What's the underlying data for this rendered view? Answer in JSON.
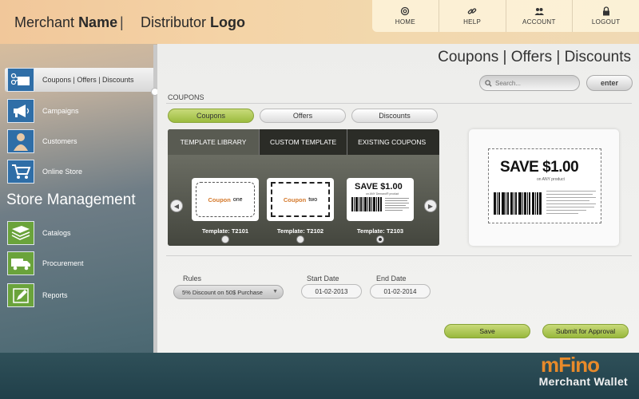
{
  "header": {
    "merchant_prefix": "Merchant",
    "merchant_bold": "Name",
    "separator": "|",
    "distributor_prefix": "Distributor",
    "distributor_bold": "Logo",
    "nav": [
      {
        "label": "HOME",
        "icon": "at-icon"
      },
      {
        "label": "HELP",
        "icon": "link-icon"
      },
      {
        "label": "ACCOUNT",
        "icon": "users-icon"
      },
      {
        "label": "LOGOUT",
        "icon": "lock-icon"
      }
    ]
  },
  "sidebar": {
    "items": [
      {
        "label": "Coupons | Offers | Discounts",
        "icon": "scissors-coupon-icon",
        "active": true
      },
      {
        "label": "Campaigns",
        "icon": "megaphone-icon"
      },
      {
        "label": "Customers",
        "icon": "person-icon"
      },
      {
        "label": "Online Store",
        "icon": "cart-icon"
      }
    ],
    "store_heading": "Store Management",
    "store_items": [
      {
        "label": "Catalogs",
        "icon": "catalog-icon"
      },
      {
        "label": "Procurement",
        "icon": "truck-icon"
      },
      {
        "label": "Reports",
        "icon": "pencil-icon"
      }
    ]
  },
  "main": {
    "page_title": "Coupons | Offers | Discounts",
    "search_placeholder": "Search...",
    "enter_label": "enter",
    "section_label": "COUPONS",
    "pills": [
      {
        "label": "Coupons",
        "active": true
      },
      {
        "label": "Offers"
      },
      {
        "label": "Discounts"
      }
    ],
    "template_tabs": [
      "TEMPLATE LIBRARY",
      "CUSTOM TEMPLATE",
      "EXISTING COUPONS"
    ],
    "templates": [
      {
        "label": "Template: T2101",
        "word": "Coupon",
        "suffix": "one"
      },
      {
        "label": "Template: T2102",
        "word": "Coupon",
        "suffix": "two"
      },
      {
        "label": "Template: T2103",
        "save": "SAVE $1.00",
        "sub": "on ANY Demand® product",
        "selected": true
      }
    ],
    "preview": {
      "save": "SAVE $1.00",
      "sub": "on ANY product"
    },
    "rules_label": "Rules",
    "rules_value": "5% Discount on 50$ Purchase",
    "start_date_label": "Start Date",
    "start_date": "01-02-2013",
    "end_date_label": "End Date",
    "end_date": "01-02-2014",
    "save_label": "Save",
    "submit_label": "Submit for Approval"
  },
  "footer": {
    "brand": "mFino",
    "brand_sub": "Merchant Wallet"
  }
}
